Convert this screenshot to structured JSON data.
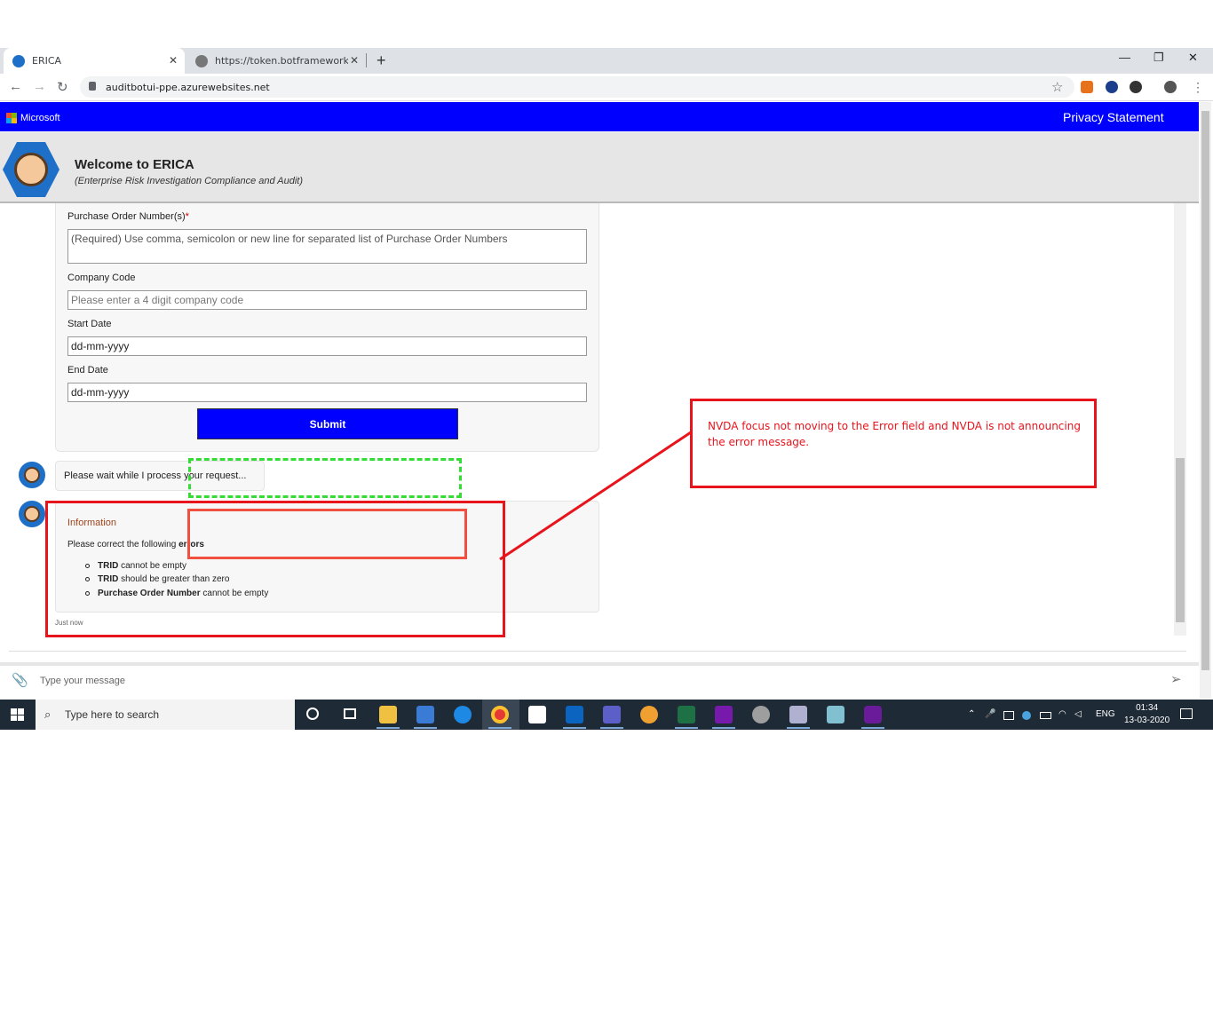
{
  "browser": {
    "tabs": [
      {
        "label": "ERICA"
      },
      {
        "label": "https://token.botframework.com"
      }
    ],
    "url": "auditbotui-ppe.azurewebsites.net",
    "close_glyph": "✕",
    "new_tab_glyph": "+",
    "window_controls": {
      "minimize": "—",
      "restore": "❐",
      "close": "✕"
    },
    "nav": {
      "back": "←",
      "forward": "→",
      "reload": "↻"
    },
    "star": "☆",
    "menu": "⋮"
  },
  "topbar": {
    "brand": "Microsoft",
    "privacy_link": "Privacy Statement",
    "background_color": "#0000ff"
  },
  "header": {
    "title": "Welcome to ERICA",
    "subtitle": "(Enterprise Risk Investigation Compliance and Audit)"
  },
  "form": {
    "po_label": "Purchase Order Number(s)",
    "po_required_mark": "*",
    "po_placeholder": "(Required) Use comma, semicolon or new line for separated list of Purchase Order Numbers",
    "company_label": "Company Code",
    "company_placeholder": "Please enter a 4 digit company code",
    "start_label": "Start Date",
    "start_value": "dd-mm-yyyy",
    "end_label": "End Date",
    "end_value": "dd-mm-yyyy",
    "submit_label": "Submit"
  },
  "chat": {
    "wait_message": "Please wait while I process your request...",
    "info_title": "Information",
    "info_text": "Please correct the following",
    "info_text_bold": "errors",
    "errors": [
      {
        "field": "TRID",
        "text": " cannot be empty"
      },
      {
        "field": "TRID",
        "text": " should be greater than zero"
      },
      {
        "field": "Purchase Order Number",
        "text": " cannot be empty"
      }
    ],
    "timestamp": "Just now"
  },
  "composer": {
    "placeholder": "Type your message",
    "attach_icon": "📎",
    "send_icon": "➢"
  },
  "annotation": {
    "text": "NVDA focus not moving to the Error field  and NVDA is not announcing the error message.",
    "color": "#e8141c"
  },
  "taskbar": {
    "search_placeholder": "Type here to search",
    "language": "ENG",
    "time": "01:34",
    "date": "13-03-2020"
  }
}
